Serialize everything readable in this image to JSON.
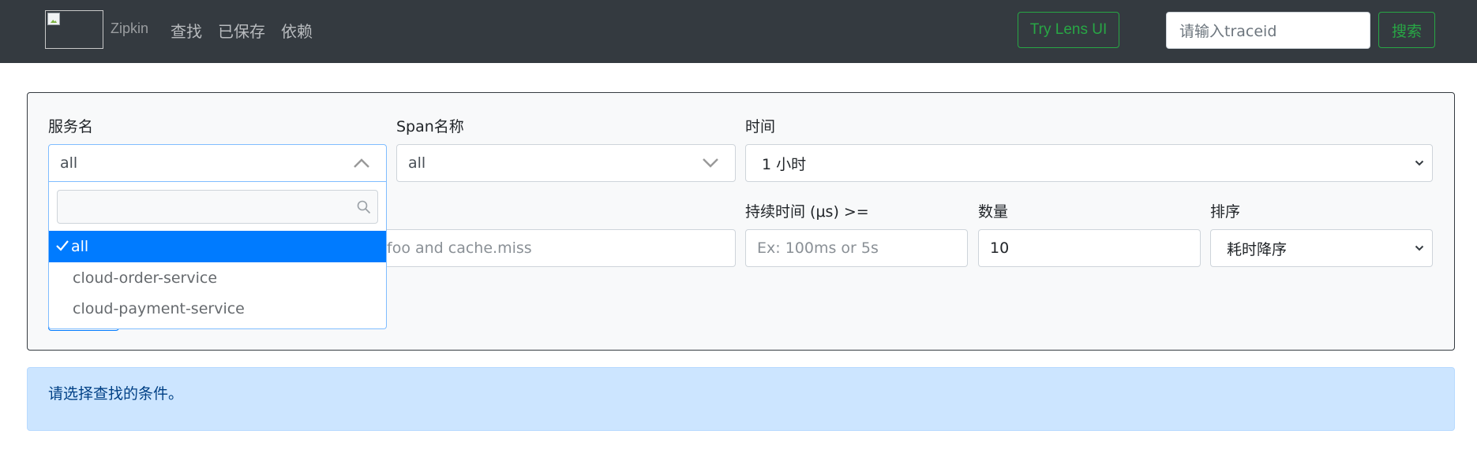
{
  "navbar": {
    "brand": "Zipkin",
    "links": [
      {
        "label": "查找"
      },
      {
        "label": "已保存"
      },
      {
        "label": "依赖"
      }
    ],
    "lens_button": "Try Lens UI",
    "traceid_placeholder": "请输入traceid",
    "search_button": "搜索"
  },
  "form": {
    "service_name": {
      "label": "服务名",
      "value": "all"
    },
    "span_name": {
      "label": "Span名称",
      "value": "all"
    },
    "time": {
      "label": "时间",
      "value": "1 小时"
    },
    "annotations": {
      "placeholder_visible": "foo and cache.miss"
    },
    "duration": {
      "label": "持续时间 (μs) >=",
      "placeholder": "Ex: 100ms or 5s"
    },
    "limit": {
      "label": "数量",
      "value": "10"
    },
    "sort": {
      "label": "排序",
      "value": "耗时降序"
    }
  },
  "service_dropdown": {
    "search_value": "",
    "options": [
      {
        "label": "all",
        "selected": true
      },
      {
        "label": "cloud-order-service",
        "selected": false
      },
      {
        "label": "cloud-payment-service",
        "selected": false
      }
    ]
  },
  "alert": {
    "text": "请选择查找的条件。"
  },
  "colors": {
    "navbar_bg": "#343a40",
    "success": "#28a745",
    "primary": "#007bff",
    "alert_bg": "#cce5ff",
    "alert_text": "#004085"
  }
}
